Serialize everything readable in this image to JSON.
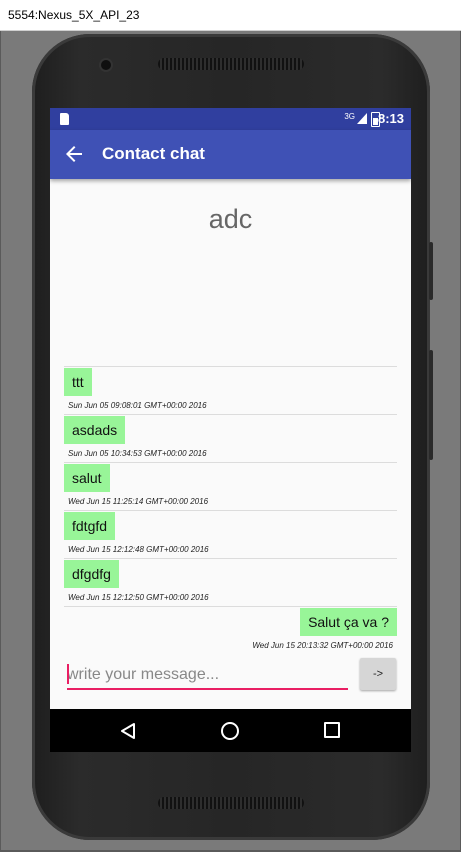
{
  "window": {
    "title": "5554:Nexus_5X_API_23"
  },
  "status_bar": {
    "network": "3G",
    "time": "8:13"
  },
  "app_bar": {
    "title": "Contact chat"
  },
  "contact": {
    "name": "adc"
  },
  "messages": [
    {
      "text": "ttt",
      "timestamp": "Sun Jun 05 09:08:01 GMT+00:00 2016",
      "direction": "incoming"
    },
    {
      "text": "asdads",
      "timestamp": "Sun Jun 05 10:34:53 GMT+00:00 2016",
      "direction": "incoming"
    },
    {
      "text": "salut",
      "timestamp": "Wed Jun 15 11:25:14 GMT+00:00 2016",
      "direction": "incoming"
    },
    {
      "text": "fdtgfd",
      "timestamp": "Wed Jun 15 12:12:48 GMT+00:00 2016",
      "direction": "incoming"
    },
    {
      "text": "dfgdfg",
      "timestamp": "Wed Jun 15 12:12:50 GMT+00:00 2016",
      "direction": "incoming"
    },
    {
      "text": "Salut ça va ?",
      "timestamp": "Wed Jun 15 20:13:32 GMT+00:00 2016",
      "direction": "outgoing"
    }
  ],
  "composer": {
    "placeholder": "write your message...",
    "value": "",
    "send_label": "->"
  },
  "colors": {
    "status_bar": "#303f9f",
    "app_bar": "#3f51b5",
    "bubble": "#98f598",
    "accent": "#e91e63"
  },
  "icons": {
    "back": "arrow-left-icon",
    "nav_back": "triangle-back-icon",
    "nav_home": "circle-home-icon",
    "nav_recents": "square-recents-icon"
  }
}
